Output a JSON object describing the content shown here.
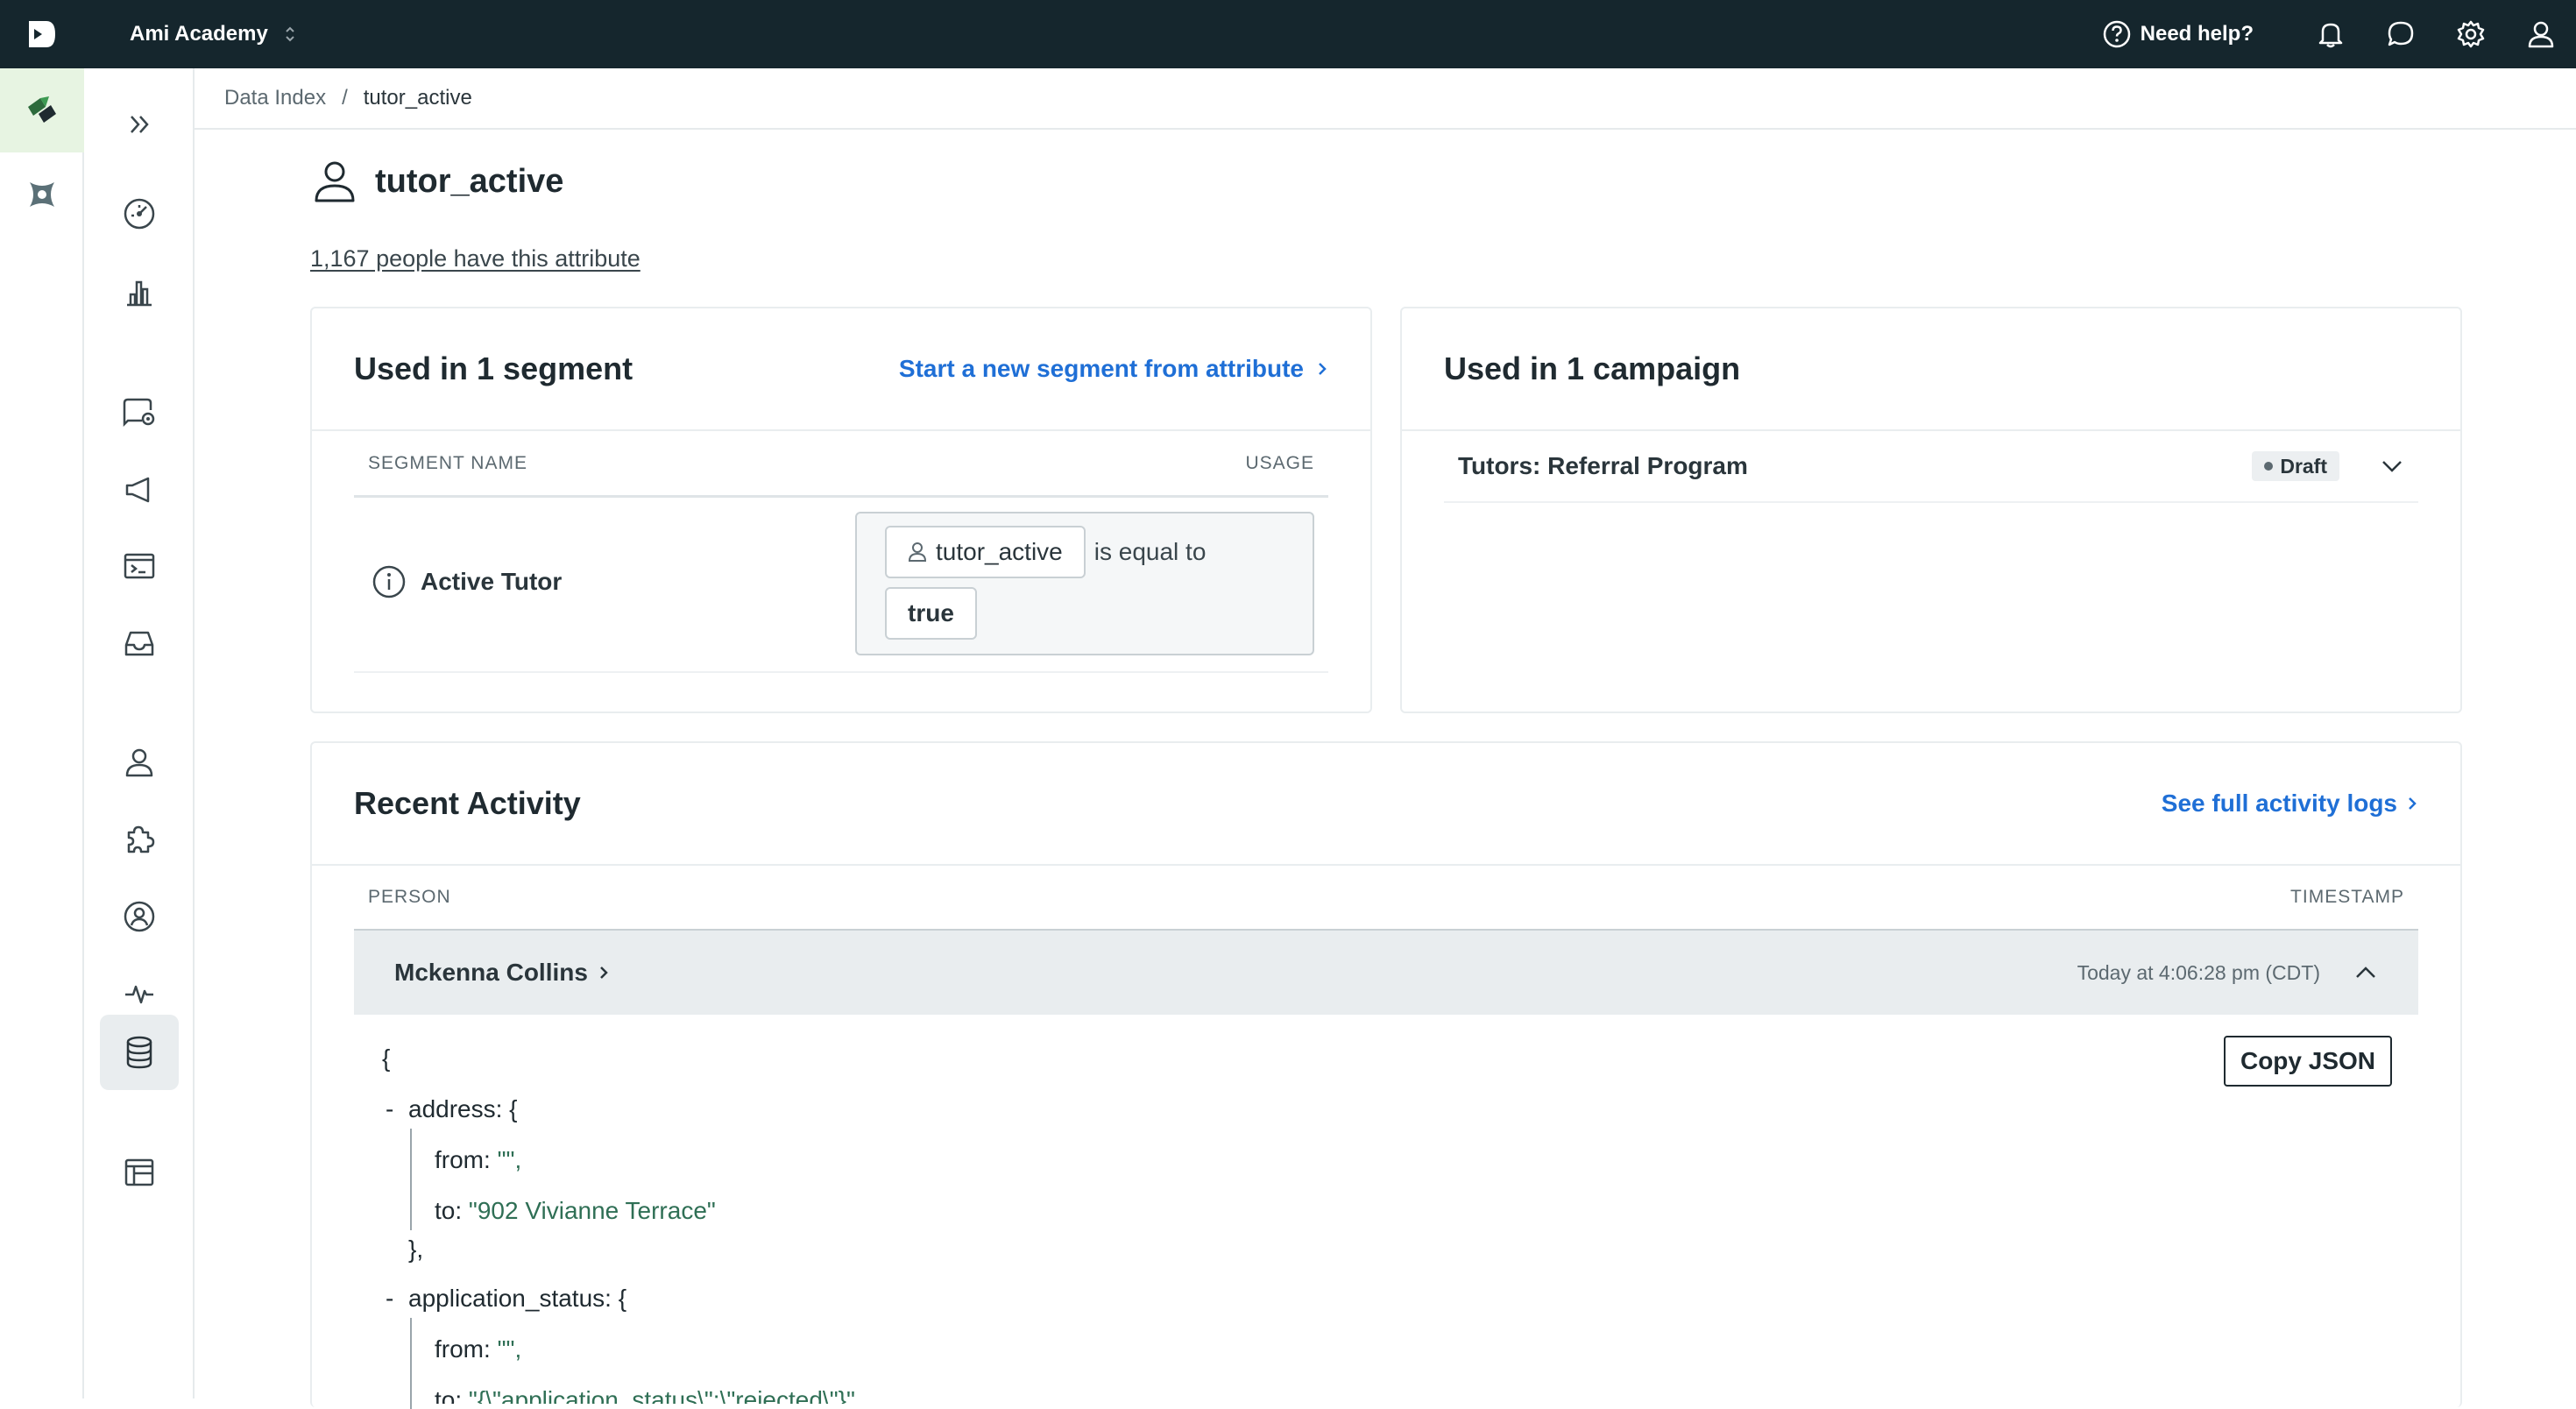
{
  "topbar": {
    "workspace": "Ami Academy",
    "help_label": "Need help?"
  },
  "breadcrumb": {
    "parent": "Data Index",
    "separator": "/",
    "current": "tutor_active"
  },
  "attribute": {
    "name": "tutor_active",
    "people_text": "1,167 people have this attribute"
  },
  "segments_card": {
    "title": "Used in 1 segment",
    "action_label": "Start a new segment from attribute",
    "col_name": "SEGMENT NAME",
    "col_usage": "USAGE",
    "rows": [
      {
        "name": "Active Tutor",
        "attr": "tutor_active",
        "operator": "is equal to",
        "value": "true"
      }
    ]
  },
  "campaign_card": {
    "title": "Used in 1 campaign",
    "rows": [
      {
        "name": "Tutors: Referral Program",
        "status": "Draft"
      }
    ]
  },
  "activity": {
    "title": "Recent Activity",
    "action_label": "See full activity logs",
    "col_person": "PERSON",
    "col_timestamp": "TIMESTAMP",
    "row": {
      "person": "Mckenna Collins",
      "timestamp": "Today at 4:06:28 pm (CDT)"
    },
    "copy_label": "Copy JSON",
    "json": {
      "open": "{",
      "addr_key": "address: {",
      "addr_from_key": "from: ",
      "addr_from_val": "\"\",",
      "addr_to_key": "to: ",
      "addr_to_val": "\"902 Vivianne Terrace\"",
      "addr_close": "},",
      "app_key": "application_status: {",
      "app_from_key": "from: ",
      "app_from_val": "\"\",",
      "app_to_key": "to: ",
      "app_to_val": "\"{\\\"application_status\\\":\\\"rejected\\\"}\"",
      "collapse": "-"
    }
  },
  "colors": {
    "topbar": "#15262d",
    "accent_green": "#3d9a52",
    "link_blue": "#1f6fd6"
  }
}
